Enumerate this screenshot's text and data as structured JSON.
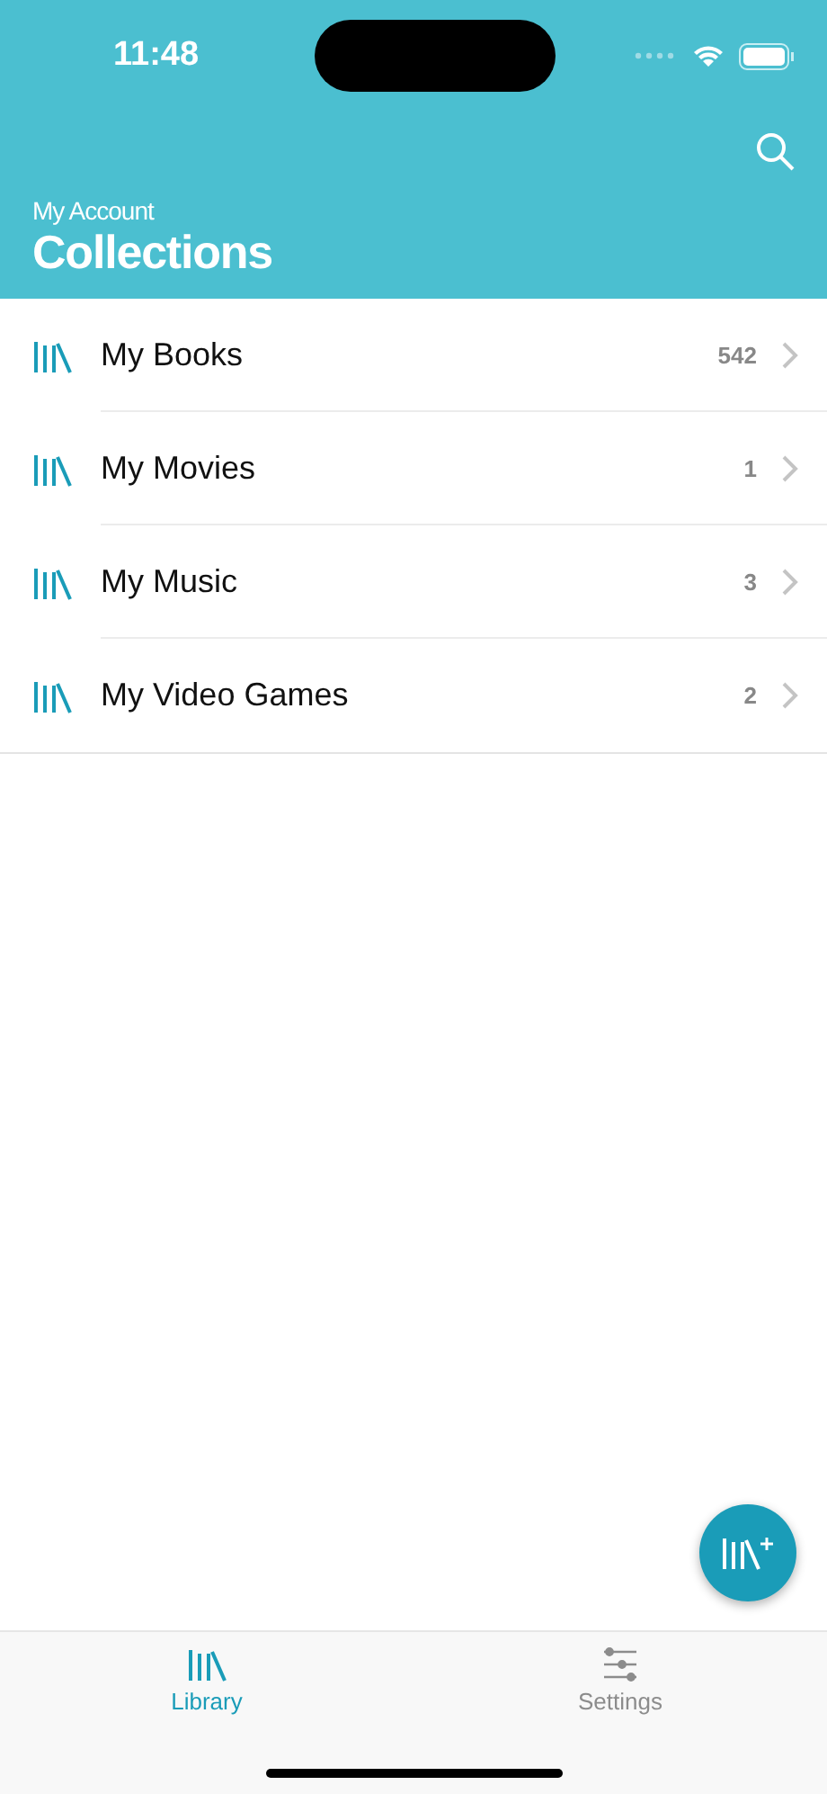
{
  "status_bar": {
    "time": "11:48"
  },
  "header": {
    "subtitle": "My Account",
    "title": "Collections"
  },
  "collections": [
    {
      "name": "My Books",
      "count": "542"
    },
    {
      "name": "My Movies",
      "count": "1"
    },
    {
      "name": "My Music",
      "count": "3"
    },
    {
      "name": "My Video Games",
      "count": "2"
    }
  ],
  "tabs": [
    {
      "label": "Library",
      "kind": "library",
      "selected": true
    },
    {
      "label": "Settings",
      "kind": "settings",
      "selected": false
    }
  ]
}
